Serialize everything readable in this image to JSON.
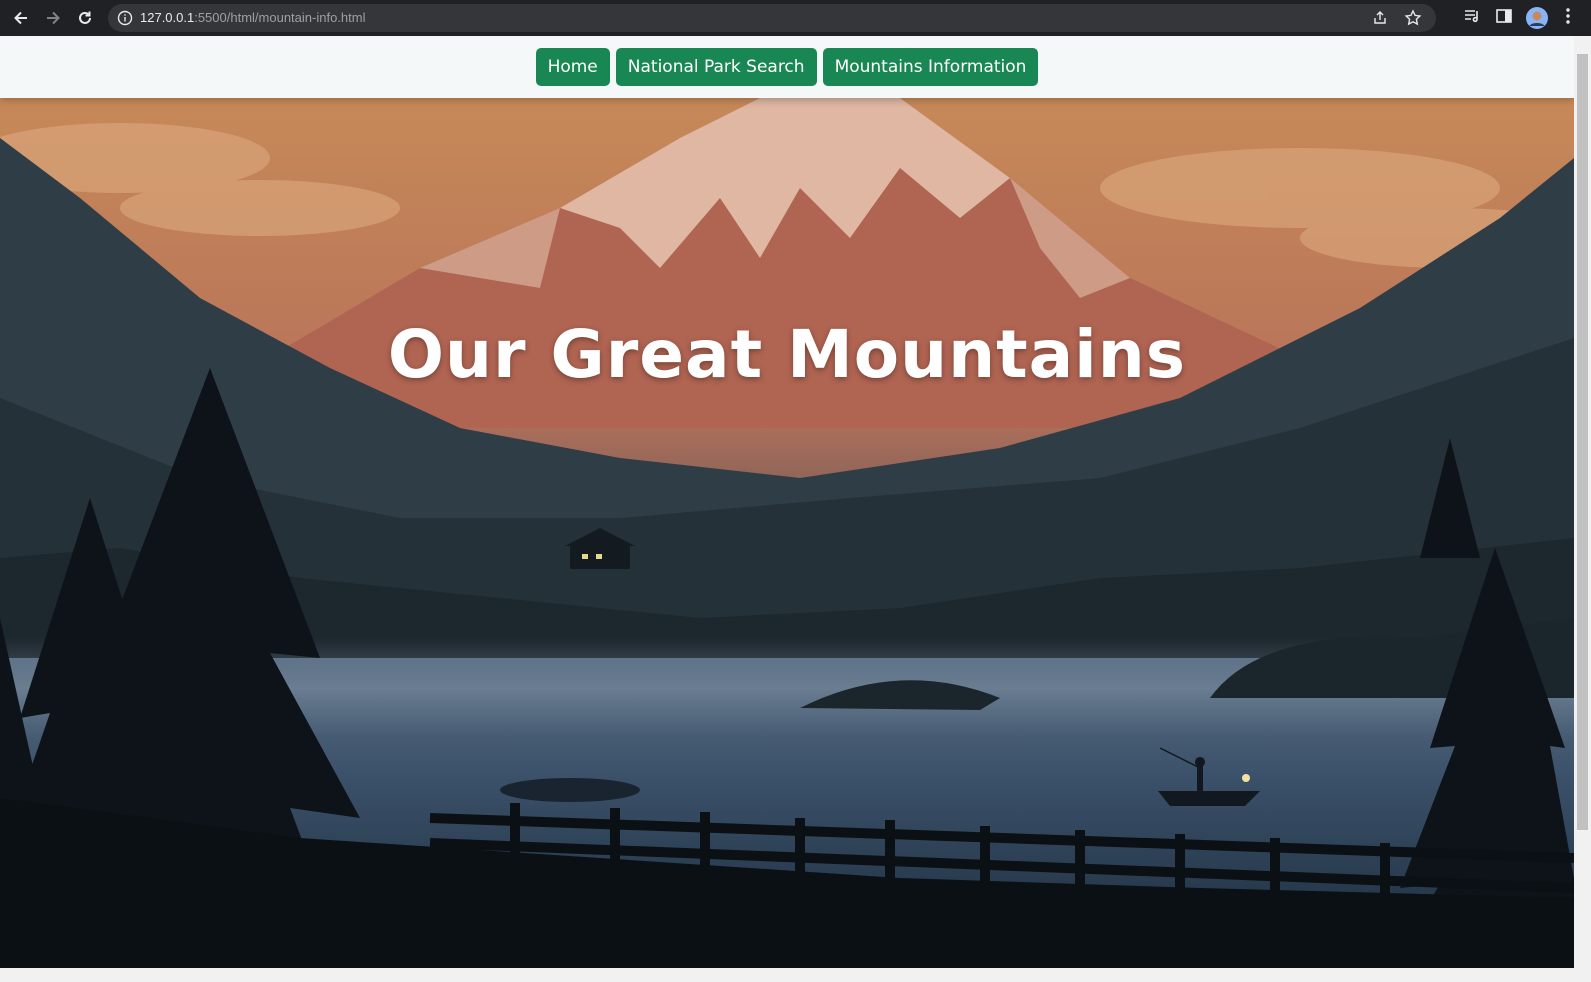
{
  "browser": {
    "url_host": "127.0.0.1",
    "url_path": ":5500/html/mountain-info.html"
  },
  "nav": {
    "items": [
      {
        "label": "Home"
      },
      {
        "label": "National Park Search"
      },
      {
        "label": "Mountains Information"
      }
    ]
  },
  "hero": {
    "title": "Our Great Mountains"
  },
  "colors": {
    "nav_button": "#198754",
    "navbar_bg": "#f5f8f9",
    "browser_chrome": "#202124"
  }
}
